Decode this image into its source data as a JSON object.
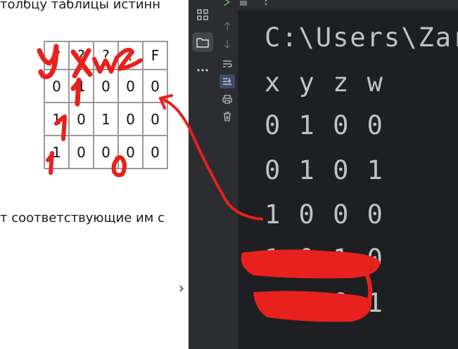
{
  "document": {
    "line_top": "толбцу таблицы истинн",
    "line_bottom": "т соответствующие им с",
    "table": [
      [
        "?",
        "?",
        "?",
        "?",
        "F"
      ],
      [
        "0",
        "1",
        "0",
        "0",
        "0"
      ],
      [
        "1",
        "0",
        "1",
        "0",
        "0"
      ],
      [
        "1",
        "0",
        "0",
        "0",
        "0"
      ]
    ],
    "chevron": "›"
  },
  "handwriting": {
    "header_letters": [
      "y",
      "x",
      "w",
      "z"
    ],
    "color": "#e8211f"
  },
  "ide": {
    "toolbar": {
      "run_icon": "run-icon",
      "stop_icon": "stop-icon",
      "more_icon": "more-vertical-icon"
    },
    "sidebar_icons": [
      "grid-icon",
      "folder-icon",
      "more-horizontal-icon"
    ],
    "console_tools": [
      "arrow-up-icon",
      "arrow-down-icon",
      "soft-wrap-icon",
      "scroll-to-end-icon",
      "print-icon",
      "trash-icon"
    ],
    "console_lines": [
      "C:\\Users\\Zar",
      "x y z w",
      "0 1 0 0",
      "0 1 0 1",
      "1 0 0 0",
      "1 0 1 0",
      "1 1 0 1"
    ],
    "colors": {
      "panel": "#2b2d30",
      "console": "#1e1f22",
      "text": "#bfc2c7"
    }
  }
}
